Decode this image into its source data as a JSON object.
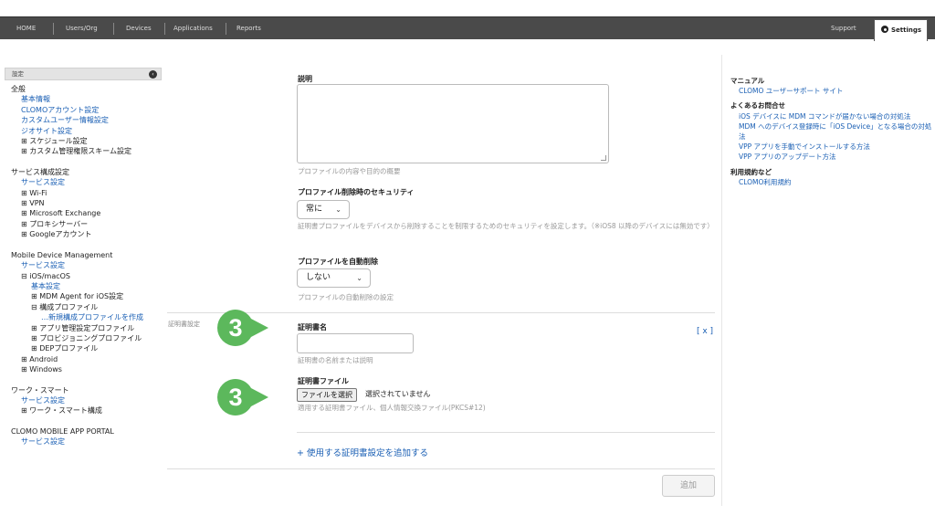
{
  "nav": {
    "items": [
      "HOME",
      "Users/Org",
      "Devices",
      "Applications",
      "Reports"
    ],
    "support": "Support",
    "settings": "Settings"
  },
  "sidebar": {
    "header": "設定",
    "lines": [
      {
        "text": "全般",
        "level": 0,
        "kind": "dark"
      },
      {
        "text": "基本情報",
        "level": 1,
        "kind": "link"
      },
      {
        "text": "CLOMOアカウント設定",
        "level": 1,
        "kind": "link"
      },
      {
        "text": "カスタムユーザー情報設定",
        "level": 1,
        "kind": "link"
      },
      {
        "text": "ジオサイト設定",
        "level": 1,
        "kind": "link"
      },
      {
        "text": "⊞ スケジュール設定",
        "level": 1,
        "kind": "dark"
      },
      {
        "text": "⊞ カスタム管理権限スキーム設定",
        "level": 1,
        "kind": "dark"
      },
      {
        "text": "",
        "level": 0,
        "kind": "gap"
      },
      {
        "text": "サービス構成設定",
        "level": 0,
        "kind": "dark"
      },
      {
        "text": "サービス設定",
        "level": 1,
        "kind": "link"
      },
      {
        "text": "⊞ Wi-Fi",
        "level": 1,
        "kind": "dark"
      },
      {
        "text": "⊞ VPN",
        "level": 1,
        "kind": "dark"
      },
      {
        "text": "⊞ Microsoft Exchange",
        "level": 1,
        "kind": "dark"
      },
      {
        "text": "⊞ プロキシサーバー",
        "level": 1,
        "kind": "dark"
      },
      {
        "text": "⊞ Googleアカウント",
        "level": 1,
        "kind": "dark"
      },
      {
        "text": "",
        "level": 0,
        "kind": "gap"
      },
      {
        "text": "Mobile Device Management",
        "level": 0,
        "kind": "dark"
      },
      {
        "text": "サービス設定",
        "level": 1,
        "kind": "link"
      },
      {
        "text": "⊟ iOS/macOS",
        "level": 1,
        "kind": "dark"
      },
      {
        "text": "基本設定",
        "level": 2,
        "kind": "link"
      },
      {
        "text": "⊞ MDM Agent for iOS設定",
        "level": 2,
        "kind": "dark"
      },
      {
        "text": "⊟ 構成プロファイル",
        "level": 2,
        "kind": "dark"
      },
      {
        "text": "…新規構成プロファイルを作成",
        "level": 3,
        "kind": "link"
      },
      {
        "text": "⊞ アプリ管理設定プロファイル",
        "level": 2,
        "kind": "dark"
      },
      {
        "text": "⊞ プロビジョニングプロファイル",
        "level": 2,
        "kind": "dark"
      },
      {
        "text": "⊞ DEPプロファイル",
        "level": 2,
        "kind": "dark"
      },
      {
        "text": "⊞ Android",
        "level": 1,
        "kind": "dark"
      },
      {
        "text": "⊞ Windows",
        "level": 1,
        "kind": "dark"
      },
      {
        "text": "",
        "level": 0,
        "kind": "gap"
      },
      {
        "text": "ワーク・スマート",
        "level": 0,
        "kind": "dark"
      },
      {
        "text": "サービス設定",
        "level": 1,
        "kind": "link"
      },
      {
        "text": "⊞ ワーク・スマート構成",
        "level": 1,
        "kind": "dark"
      },
      {
        "text": "",
        "level": 0,
        "kind": "gap"
      },
      {
        "text": "CLOMO MOBILE APP PORTAL",
        "level": 0,
        "kind": "dark"
      },
      {
        "text": "サービス設定",
        "level": 1,
        "kind": "link"
      }
    ]
  },
  "form": {
    "description_label": "説明",
    "description_hint": "プロファイルの内容や目的の概要",
    "security_label": "プロファイル削除時のセキュリティ",
    "security_value": "常に",
    "security_hint": "証明書プロファイルをデバイスから削除することを制限するためのセキュリティを設定します。（※iOS8 以降のデバイスには無効です）",
    "autodelete_label": "プロファイルを自動削除",
    "autodelete_value": "しない",
    "autodelete_hint": "プロファイルの自動削除の設定",
    "cert_section_label": "証明書設定",
    "cert_name_label": "証明書名",
    "cert_name_hint": "証明書の名前または説明",
    "remove_label": "[ x ]",
    "cert_file_label": "証明書ファイル",
    "file_button": "ファイルを選択",
    "file_status": "選択されていません",
    "cert_file_hint": "適用する証明書ファイル、個人情報交換ファイル(PKCS#12)",
    "add_cert_link": "+ 使用する証明書設定を追加する",
    "add_button": "追加"
  },
  "callouts": [
    "3",
    "3"
  ],
  "right_panel": {
    "manual_heading": "マニュアル",
    "manual_link": "CLOMO ユーザーサポート サイト",
    "faq_heading": "よくあるお問合せ",
    "faq_links": [
      "iOS デバイスに MDM コマンドが届かない場合の対処法",
      "MDM へのデバイス登録時に「iOS Device」となる場合の対処法",
      "VPP アプリを手動でインストールする方法",
      "VPP アプリのアップデート方法"
    ],
    "terms_heading": "利用規約など",
    "terms_link": "CLOMO利用規約"
  },
  "colors": {
    "accent": "#1a5fb4",
    "callout": "#5cb85c",
    "nav_bg": "#4a4a4a"
  }
}
